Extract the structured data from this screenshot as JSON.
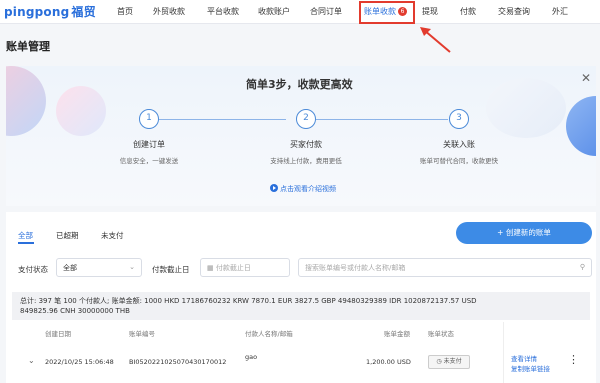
{
  "brand": {
    "logo_text": "pingpong",
    "logo_cn": "福贸"
  },
  "nav": {
    "items": [
      "首页",
      "外贸收款",
      "平台收款",
      "收款账户",
      "合同订单",
      "账单收款",
      "提现",
      "付款",
      "交易查询",
      "外汇"
    ],
    "active_badge": "6"
  },
  "page": {
    "title": "账单管理"
  },
  "banner": {
    "title": "简单3步，收款更高效",
    "steps": [
      {
        "num": "1",
        "title": "创建订单",
        "desc": "信息安全，一键发送"
      },
      {
        "num": "2",
        "title": "买家付款",
        "desc": "支持线上付款，费用更低"
      },
      {
        "num": "3",
        "title": "关联入账",
        "desc": "账单可替代合同，收款更快"
      }
    ],
    "video_link": "点击观看介绍视频",
    "close": "✕"
  },
  "tabs": [
    "全部",
    "已超期",
    "未支付"
  ],
  "create_button": "+ 创建新的账单",
  "filters": {
    "status_label": "支付状态",
    "status_value": "全部",
    "deadline_label": "付款截止日",
    "deadline_placeholder": "付款截止日",
    "search_placeholder": "搜索账单编号或付款人名称/邮箱"
  },
  "summary": {
    "line1": "总计: 397 笔   100 个付款人;   账单金额: 1000 HKD  17186760232 KRW  7870.1 EUR  3827.5 GBP  49480329389 IDR  1020872137.57 USD",
    "line2": "849825.96 CNH  30000000 THB"
  },
  "table": {
    "headers": [
      "创建日期",
      "账单编号",
      "付款人名称/邮箱",
      "账单金额",
      "账单状态"
    ],
    "row": {
      "date": "2022/10/25 15:06:48",
      "number": "BI0520221025070430170012",
      "payer": "gao",
      "amount": "1,200.00 USD",
      "status": "未支付",
      "action1": "查看详情",
      "action2": "复制账单链接"
    }
  }
}
